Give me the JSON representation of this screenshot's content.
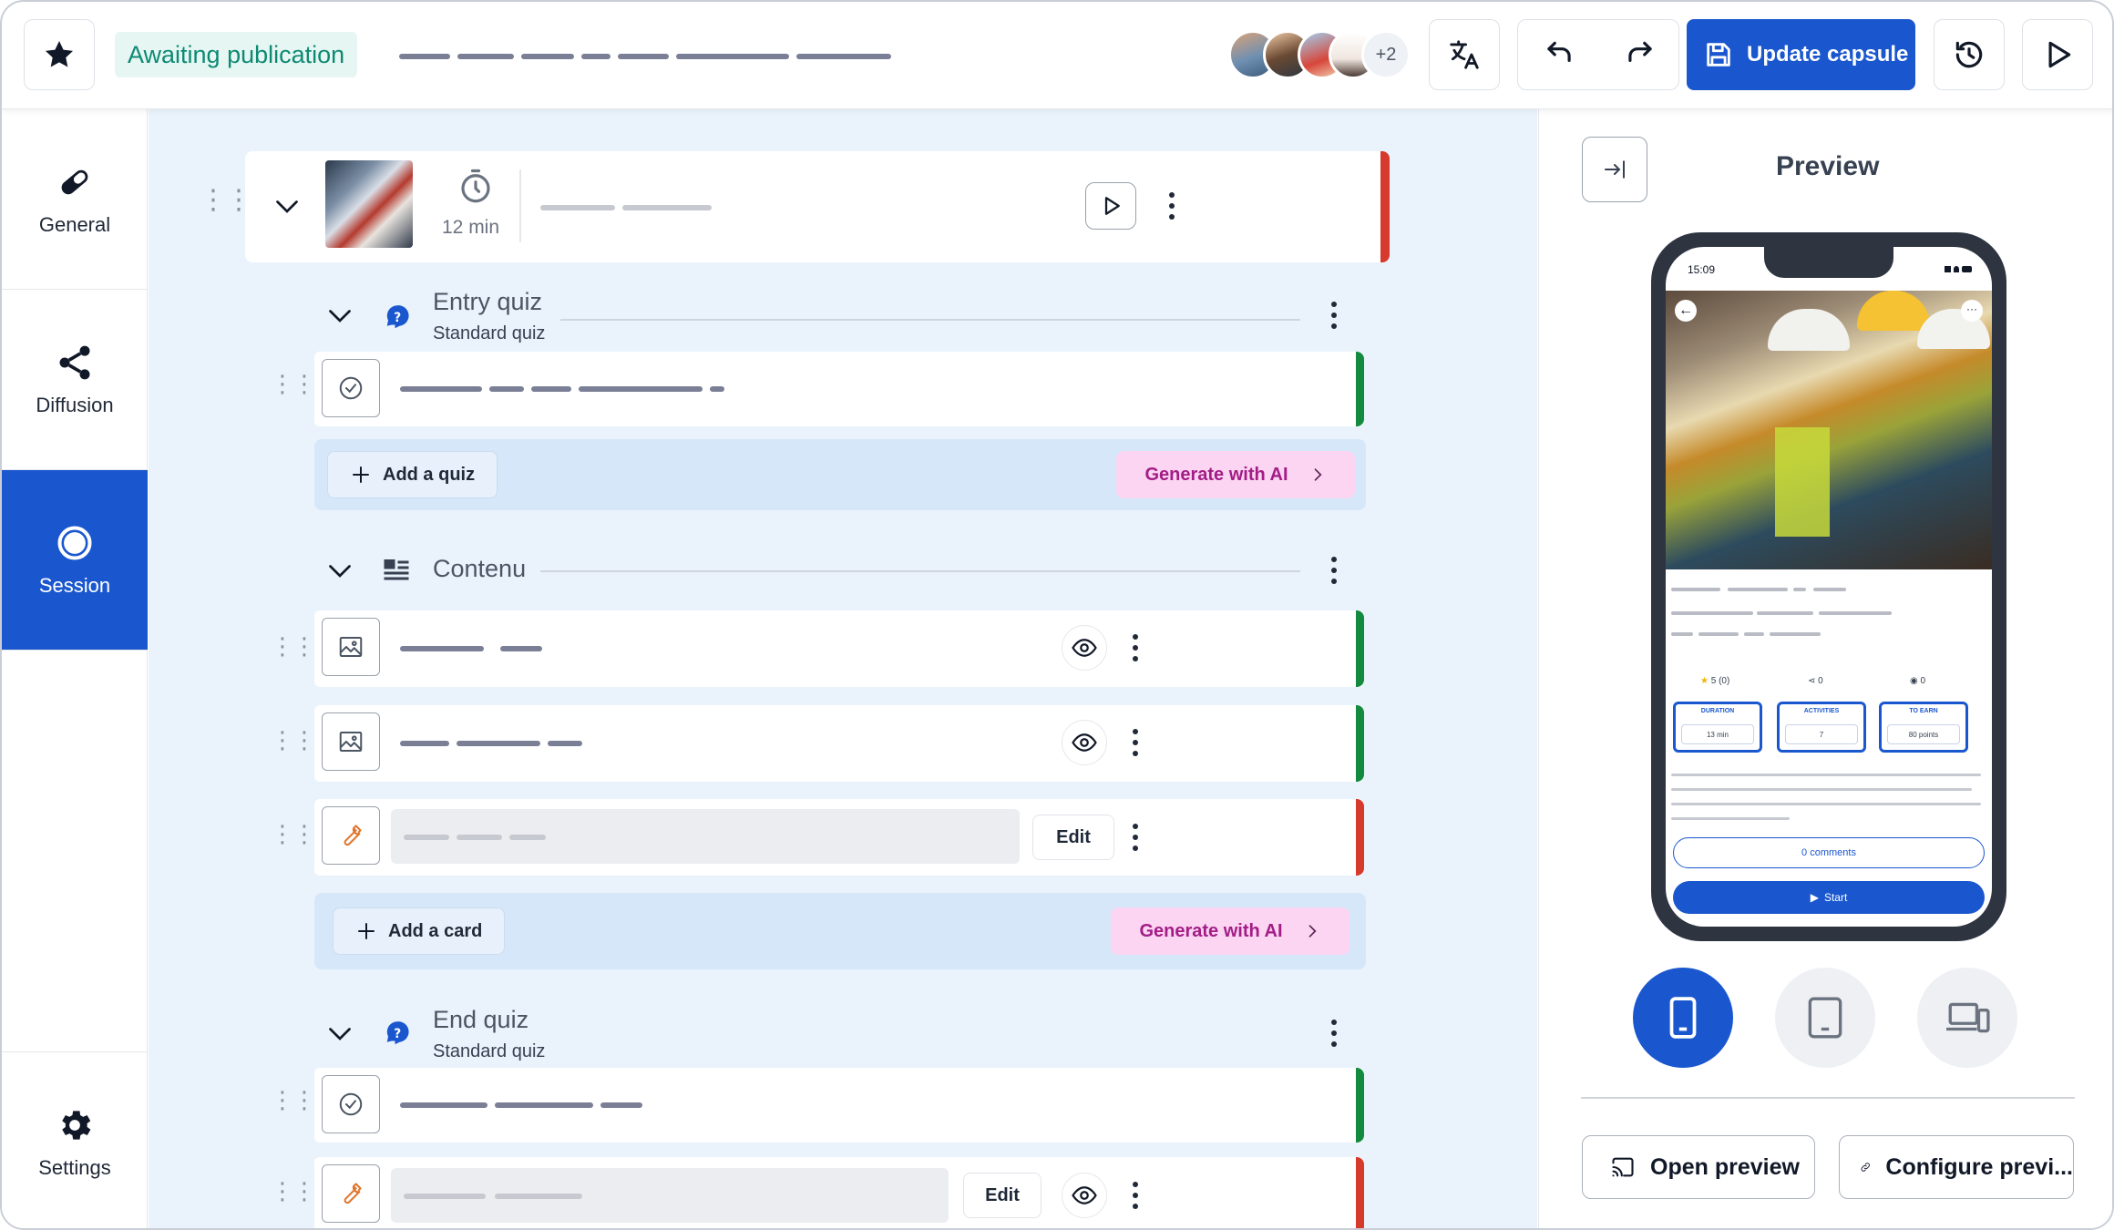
{
  "header": {
    "status": "Awaiting publication",
    "avatars_more": "+2",
    "update_label": "Update capsule"
  },
  "nav": {
    "items": [
      {
        "label": "General",
        "icon": "pill-icon"
      },
      {
        "label": "Diffusion",
        "icon": "share-icon"
      },
      {
        "label": "Session",
        "icon": "radio-circle-icon",
        "active": true
      },
      {
        "label": "Settings",
        "icon": "gear-icon"
      }
    ]
  },
  "module": {
    "duration": "12 min"
  },
  "entry_quiz": {
    "title": "Entry quiz",
    "subtitle": "Standard quiz"
  },
  "content": {
    "title": "Contenu"
  },
  "end_quiz": {
    "title": "End quiz",
    "subtitle": "Standard quiz"
  },
  "actions": {
    "add_quiz": "Add a quiz",
    "add_card": "Add a card",
    "generate_ai": "Generate with AI",
    "edit": "Edit"
  },
  "preview": {
    "title": "Preview",
    "open_label": "Open preview",
    "configure_label": "Configure previ...",
    "phone": {
      "time": "15:09",
      "rating": "5 (0)",
      "shares": "0",
      "views": "0",
      "duration_title": "DURATION",
      "duration_value": "13 min",
      "activities_title": "ACTIVITIES",
      "activities_value": "7",
      "earn_title": "TO EARN",
      "earn_value": "80 points",
      "comments": "0 comments",
      "start": "Start"
    }
  },
  "colors": {
    "primary": "#1a57cf",
    "status_ok": "#138a3f",
    "status_error": "#d53a2c",
    "ai_bg": "#fbd5f2",
    "ai_text": "#a31d86",
    "badge_bg": "#e6f6f3",
    "badge_text": "#0e8a73"
  }
}
